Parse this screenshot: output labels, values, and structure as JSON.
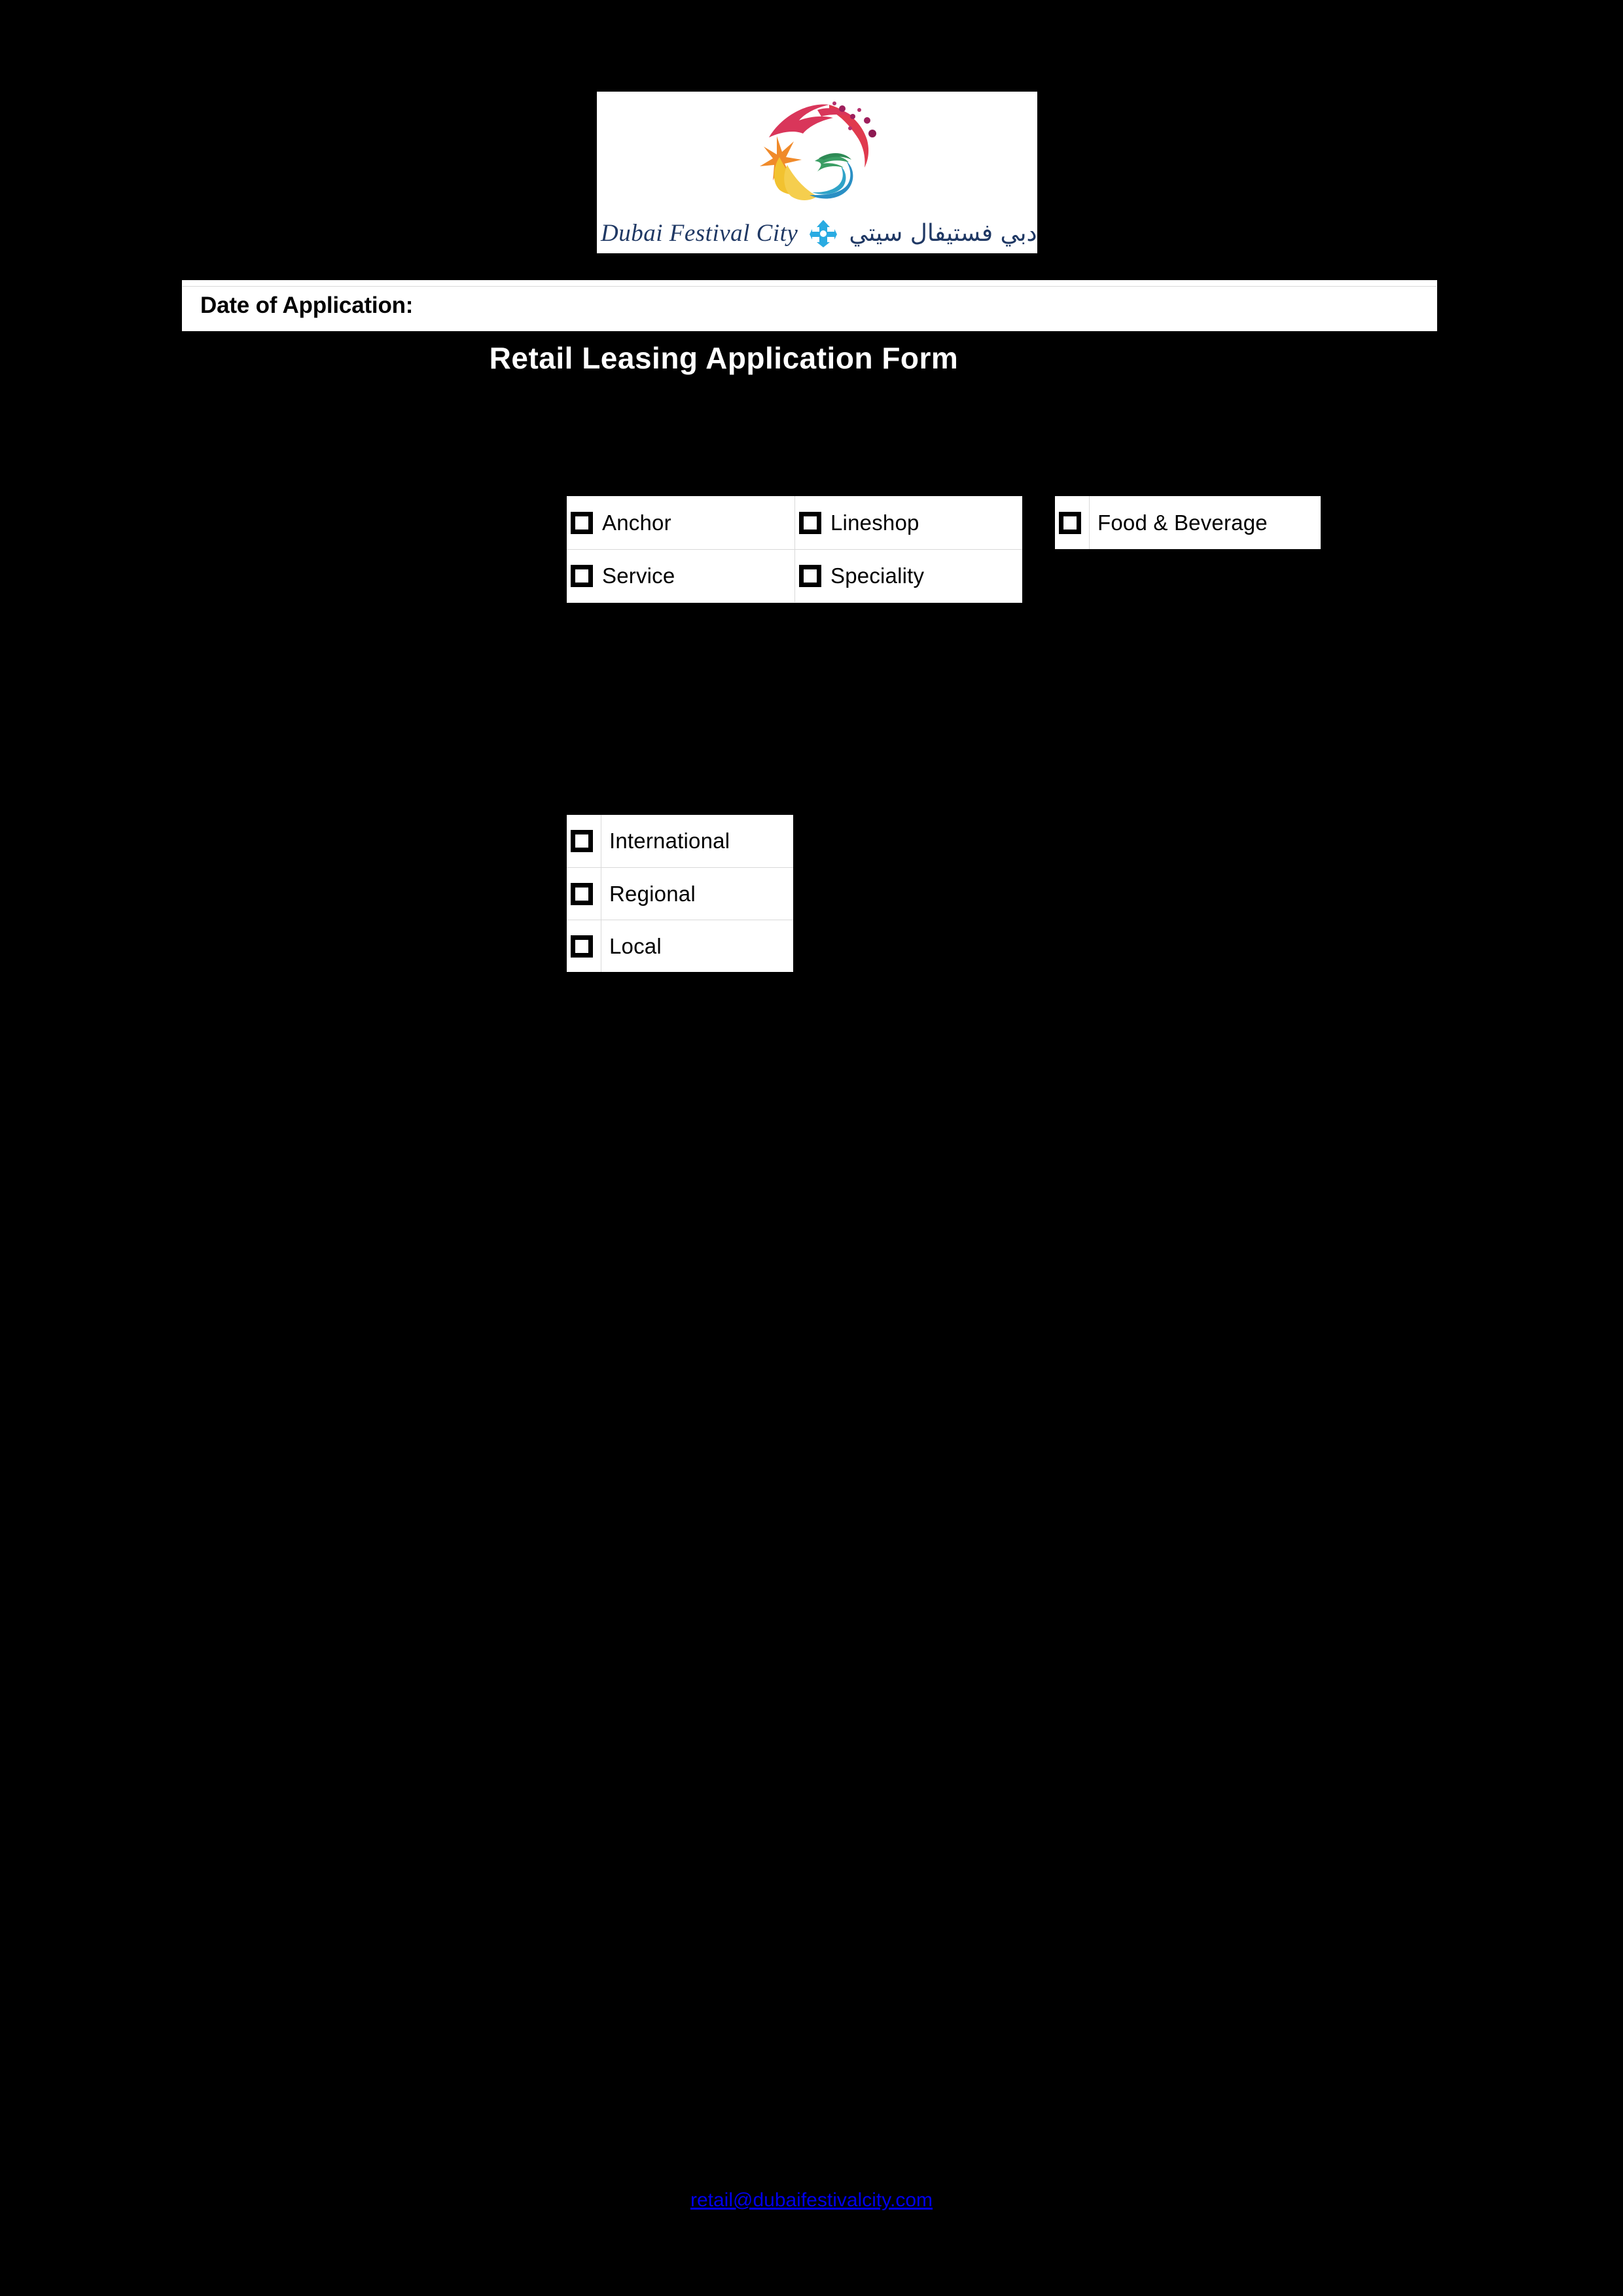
{
  "logo": {
    "english_name": "Dubai Festival City",
    "arabic_name": "دبي فستيفال سيتي",
    "emblem_colors": {
      "crimson": "#d9365a",
      "red": "#e03a4e",
      "magenta": "#9e1f5c",
      "orange": "#f08a2a",
      "gold": "#f2c230",
      "teal": "#2fa3c8",
      "blue": "#2a8fc4",
      "green": "#3a9e64"
    },
    "diamond_color": "#29abe2"
  },
  "header": {
    "date_label": "Date of Application:",
    "date_value": ""
  },
  "title": "Retail Leasing Application Form",
  "store_type": {
    "rows": [
      [
        {
          "label": "Anchor",
          "checked": false
        },
        {
          "label": "Lineshop",
          "checked": false
        }
      ],
      [
        {
          "label": "Service",
          "checked": false
        },
        {
          "label": "Speciality",
          "checked": false
        }
      ]
    ]
  },
  "food_beverage": {
    "label": "Food &  Beverage",
    "checked": false
  },
  "brand_origin": {
    "options": [
      {
        "label": "International",
        "checked": false
      },
      {
        "label": "Regional",
        "checked": false
      },
      {
        "label": "Local",
        "checked": false
      }
    ]
  },
  "footer": {
    "email": "retail@dubaifestivalcity.com",
    "email_color": "#0000ee"
  }
}
